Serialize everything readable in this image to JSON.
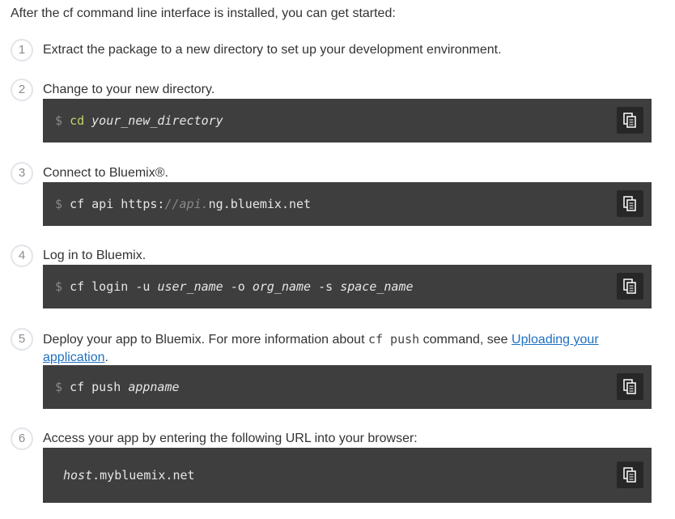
{
  "intro": "After the cf command line interface is installed, you can get started:",
  "steps": [
    {
      "number": "1",
      "text": "Extract the package to a new directory to set up your development environment."
    },
    {
      "number": "2",
      "text": "Change to your new directory.",
      "command": {
        "prompt": "$",
        "keyword": "cd",
        "arg": "your_new_directory"
      }
    },
    {
      "number": "3",
      "text": "Connect to Bluemix®.",
      "command": {
        "prompt": "$",
        "pre": "cf api https:",
        "dim": "//api.",
        "post": "ng.bluemix.net"
      }
    },
    {
      "number": "4",
      "text": "Log in to Bluemix.",
      "command": {
        "prompt": "$",
        "p1": "cf login -u ",
        "a1": "user_name",
        "p2": " -o ",
        "a2": "org_name",
        "p3": " -s ",
        "a3": "space_name"
      }
    },
    {
      "number": "5",
      "text_before": "Deploy your app to Bluemix. For more information about ",
      "inline_code": "cf push",
      "text_middle": " command, see ",
      "link": "Uploading your application",
      "text_after": ".",
      "command": {
        "prompt": "$",
        "pre": "cf push ",
        "arg": "appname"
      }
    },
    {
      "number": "6",
      "text": "Access your app by entering the following URL into your browser:",
      "command": {
        "host": "host",
        "post": ".mybluemix.net"
      }
    }
  ],
  "icons": {
    "copy": "copy-icon"
  }
}
